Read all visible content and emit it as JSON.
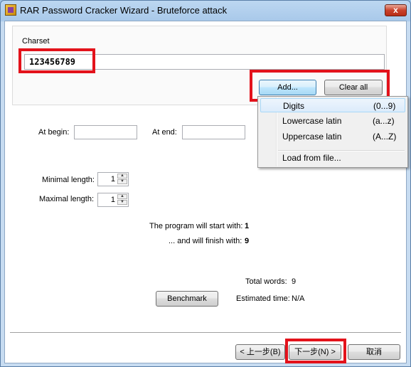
{
  "window": {
    "title": "RAR Password Cracker Wizard - Bruteforce attack",
    "close_glyph": "x"
  },
  "charset": {
    "group_label": "Charset",
    "value": "123456789",
    "add_label": "Add...",
    "clear_label": "Clear all"
  },
  "menu": {
    "items": [
      {
        "label": "Digits",
        "hint": "(0...9)"
      },
      {
        "label": "Lowercase latin",
        "hint": "(a...z)"
      },
      {
        "label": "Uppercase latin",
        "hint": "(A...Z)"
      },
      {
        "label": "Load from file..."
      }
    ]
  },
  "affix": {
    "begin_label": "At begin:",
    "begin_value": "",
    "end_label": "At end:",
    "end_value": ""
  },
  "length": {
    "min_label": "Minimal length:",
    "min_value": "1",
    "max_label": "Maximal length:",
    "max_value": "1"
  },
  "info": {
    "start_label": "The program will start with:",
    "start_value": "1",
    "finish_label": "... and will finish with:",
    "finish_value": "9",
    "total_label": "Total words:",
    "total_value": "9",
    "time_label": "Estimated time:",
    "time_value": "N/A",
    "benchmark_label": "Benchmark"
  },
  "footer": {
    "back_label": "< 上一步(B)",
    "next_label": "下一步(N) >",
    "cancel_label": "取消"
  },
  "colors": {
    "highlight": "#e3121b",
    "menu_hover": "#dcebfb"
  }
}
